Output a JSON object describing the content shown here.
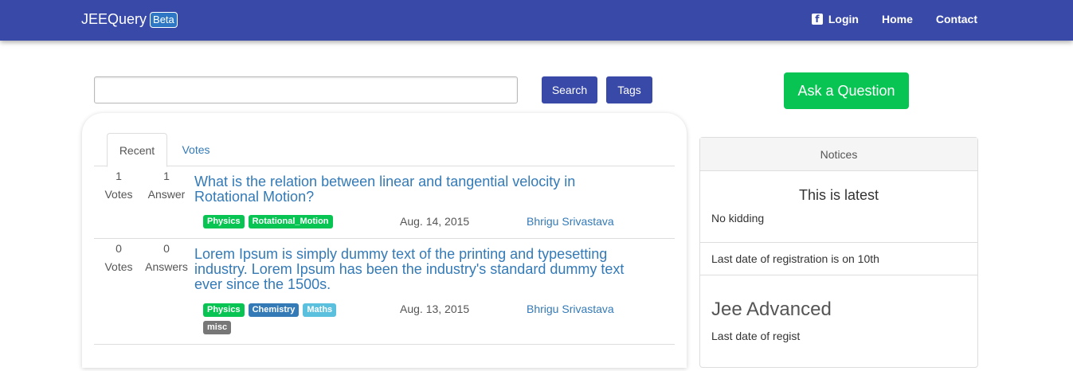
{
  "navbar": {
    "brand": "JEEQuery",
    "badge": "Beta",
    "links": {
      "login": "Login",
      "home": "Home",
      "contact": "Contact"
    }
  },
  "search": {
    "placeholder": "",
    "search_label": "Search",
    "tags_label": "Tags",
    "ask_label": "Ask a Question"
  },
  "tabs": {
    "recent": "Recent",
    "votes": "Votes"
  },
  "questions": [
    {
      "votes_count": "1",
      "votes_label": "Votes",
      "answers_count": "1",
      "answers_label": "Answer",
      "title": "What is the relation between linear and tangential velocity in Rotational Motion?",
      "tags": [
        "Physics",
        "Rotational_Motion"
      ],
      "date": "Aug. 14, 2015",
      "author": "Bhrigu Srivastava"
    },
    {
      "votes_count": "0",
      "votes_label": "Votes",
      "answers_count": "0",
      "answers_label": "Answers",
      "title": "Lorem Ipsum is simply dummy text of the printing and typesetting industry. Lorem Ipsum has been the industry's standard dummy text ever since the 1500s.",
      "tags": [
        "Physics",
        "Chemistry",
        "Maths",
        "misc"
      ],
      "date": "Aug. 13, 2015",
      "author": "Bhrigu Srivastava"
    }
  ],
  "notices": {
    "header": "Notices",
    "items": [
      {
        "title": "This is latest",
        "text": "No kidding"
      },
      {
        "text": "Last date of registration is on 10th"
      },
      {
        "title": "Jee Advanced",
        "text": "Last date of regist"
      }
    ]
  },
  "colors": {
    "navbar": "#3949a8",
    "primary_button": "#3949a8",
    "ask_button": "#08c553",
    "link": "#337ab7",
    "tag_physics": "#08c553",
    "tag_chemistry": "#337ab7",
    "tag_maths": "#5bc0de",
    "tag_misc": "#777777"
  }
}
